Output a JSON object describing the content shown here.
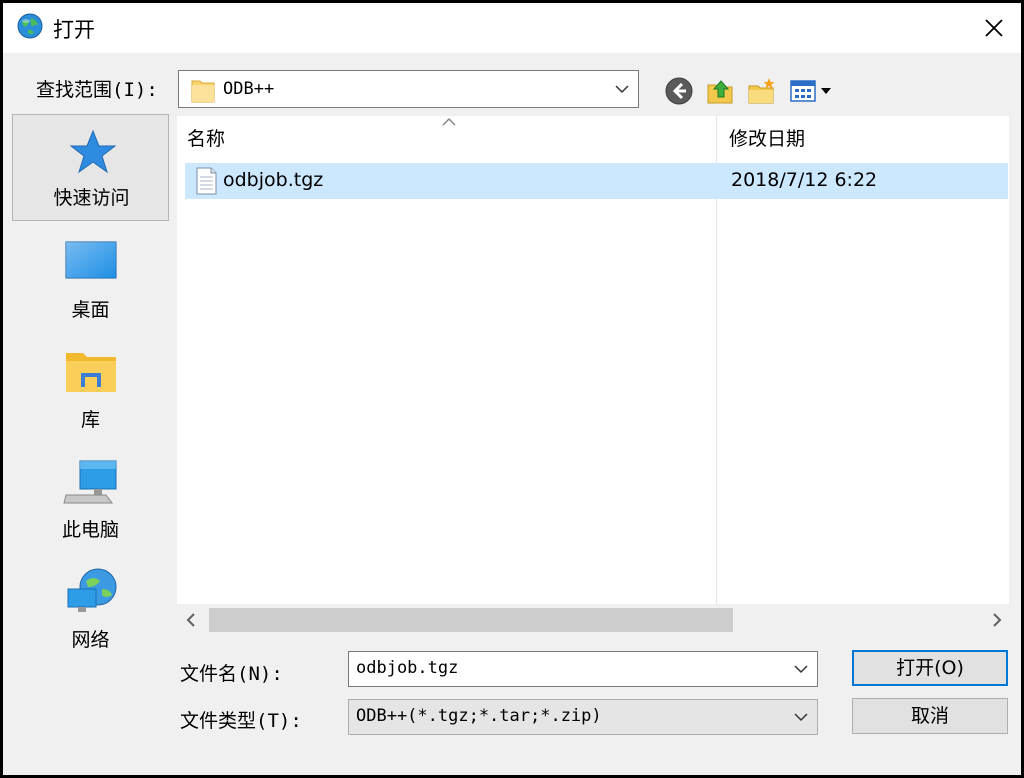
{
  "window": {
    "title": "打开",
    "close_label": "关闭"
  },
  "lookin": {
    "label": "查找范围(I):",
    "value": "ODB++"
  },
  "toolbar": {
    "back": "back-icon",
    "up": "up-folder-icon",
    "new_folder": "new-folder-icon",
    "view": "view-menu-icon"
  },
  "places": [
    {
      "label": "快速访问",
      "icon": "star-icon"
    },
    {
      "label": "桌面",
      "icon": "desktop-icon"
    },
    {
      "label": "库",
      "icon": "library-icon"
    },
    {
      "label": "此电脑",
      "icon": "computer-icon"
    },
    {
      "label": "网络",
      "icon": "network-icon"
    }
  ],
  "filelist": {
    "columns": [
      "名称",
      "修改日期"
    ],
    "rows": [
      {
        "name": "odbjob.tgz",
        "modified": "2018/7/12 6:22",
        "selected": true
      }
    ]
  },
  "filename": {
    "label": "文件名(N):",
    "value": "odbjob.tgz"
  },
  "filetype": {
    "label": "文件类型(T):",
    "value": "ODB++(*.tgz;*.tar;*.zip)"
  },
  "buttons": {
    "open": "打开(O)",
    "cancel": "取消"
  },
  "colors": {
    "selection": "#cce8ff",
    "accent": "#0078d7",
    "window_bg": "#f0f0f0"
  }
}
